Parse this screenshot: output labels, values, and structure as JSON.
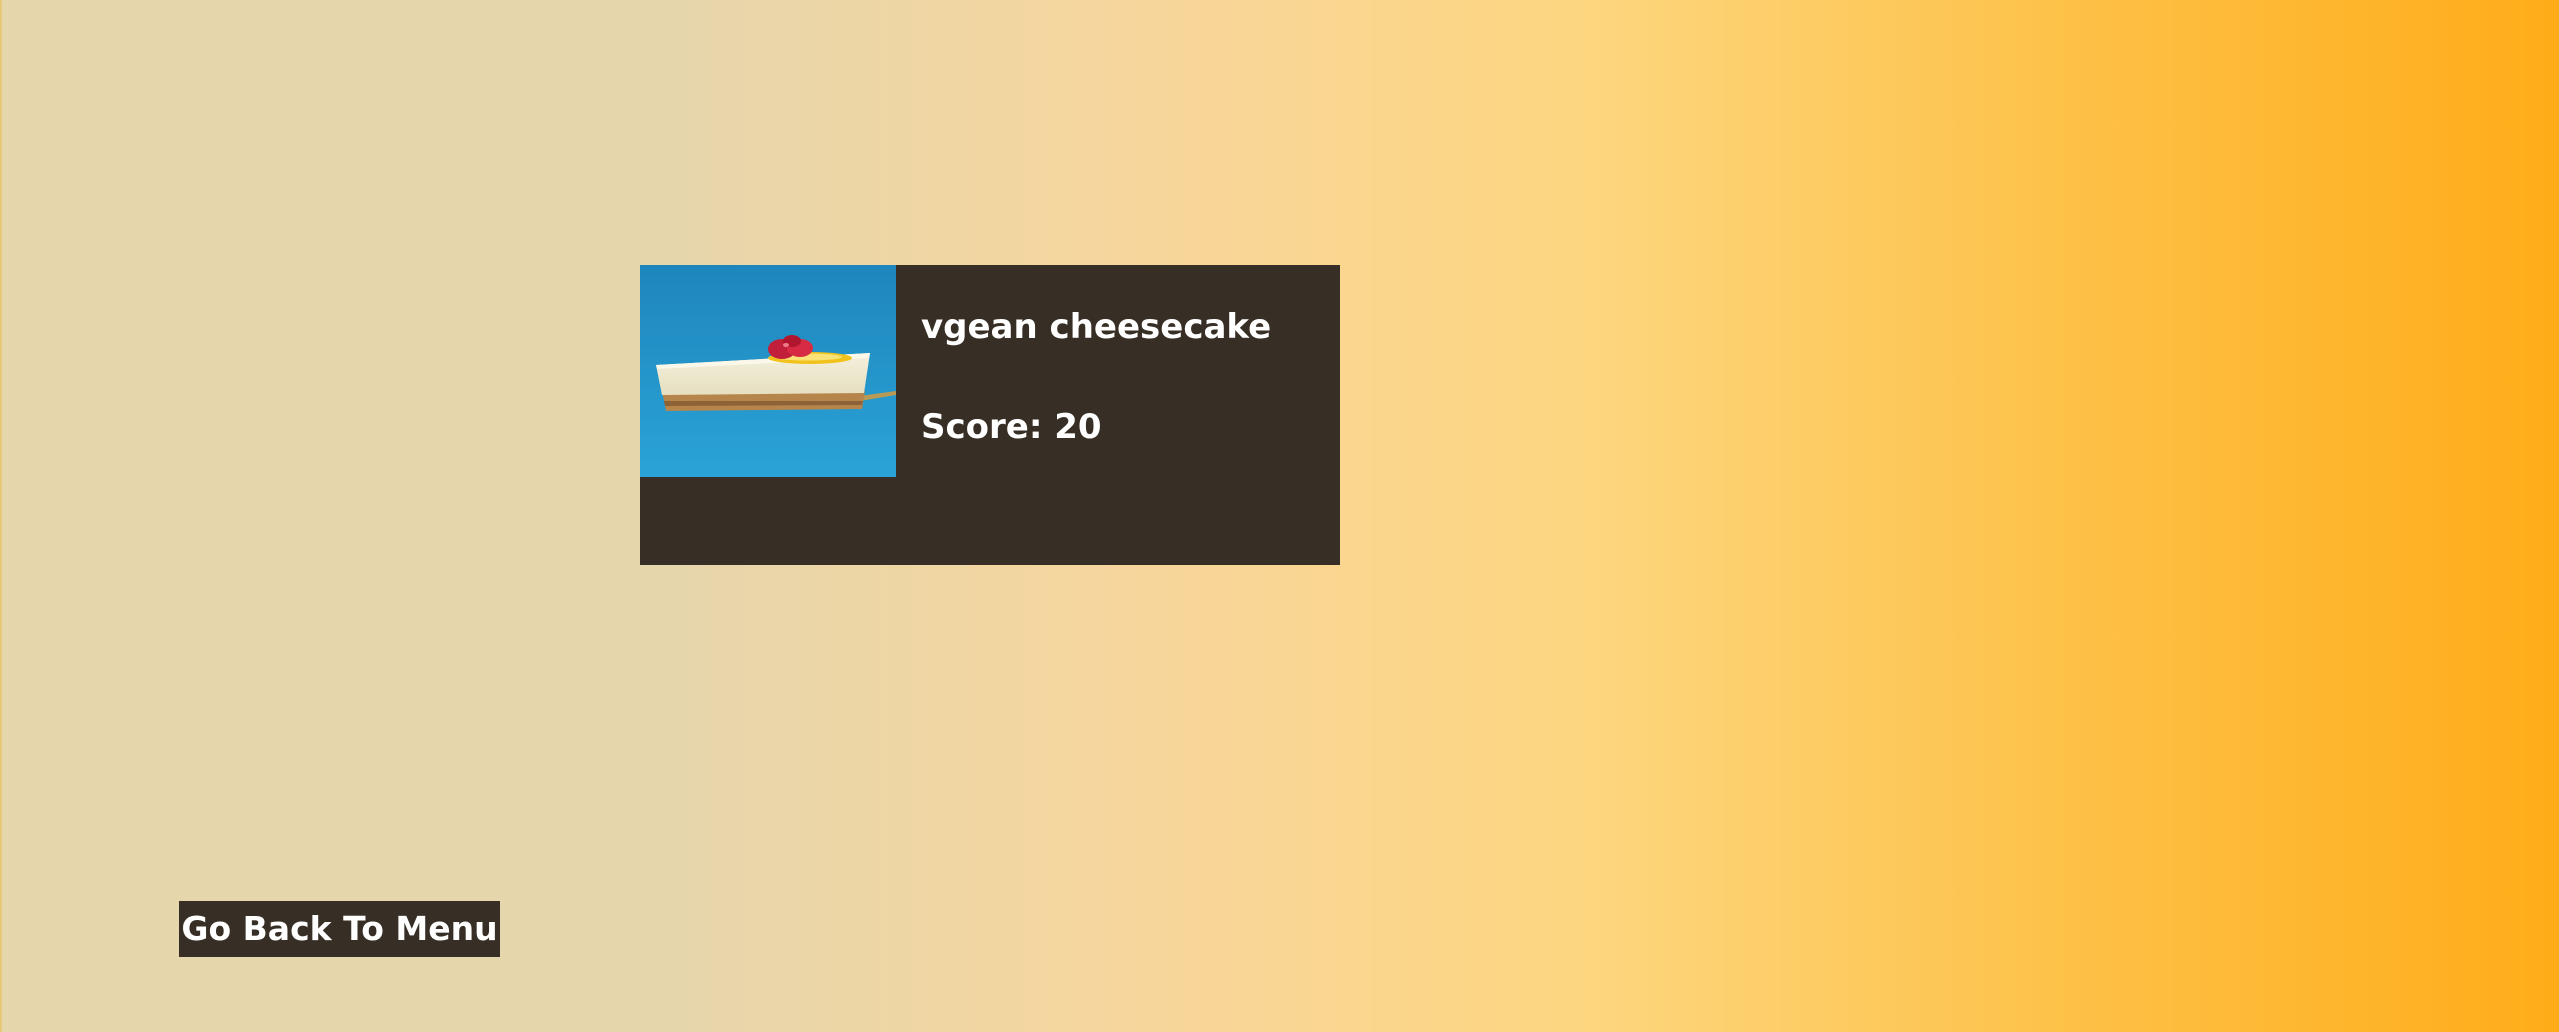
{
  "result_card": {
    "image_icon": "cheesecake-photo",
    "title": "vgean cheesecake",
    "score_label": "Score: 20"
  },
  "back_button": {
    "label": "Go Back To Menu"
  },
  "colors": {
    "card_background": "#372f25",
    "button_background": "#372f25",
    "text": "#ffffff",
    "gradient_start": "#e6d6ac",
    "gradient_end": "#ffac18"
  }
}
